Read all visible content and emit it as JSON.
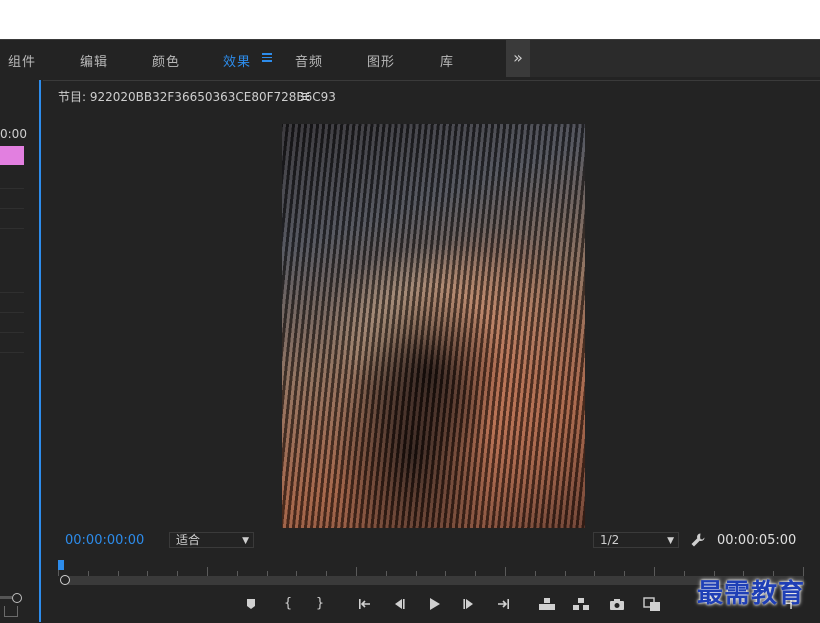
{
  "workspace_tabs": [
    {
      "label": "组件",
      "active": false
    },
    {
      "label": "编辑",
      "active": false
    },
    {
      "label": "颜色",
      "active": false
    },
    {
      "label": "效果",
      "active": true
    },
    {
      "label": "音频",
      "active": false
    },
    {
      "label": "图形",
      "active": false
    },
    {
      "label": "库",
      "active": false
    }
  ],
  "left_panel": {
    "timecode": "0:00"
  },
  "program_monitor": {
    "title": "节目: 922020BB32F36650363CE80F728B6C93",
    "current_time": "00:00:00:00",
    "duration": "00:00:05:00",
    "zoom_select": "适合",
    "resolution_select": "1/2"
  },
  "watermark": "最需教育",
  "colors": {
    "accent": "#2d8ceb",
    "clip": "#e27fe0",
    "background": "#232323"
  },
  "icons": [
    "more-tabs-icon",
    "panel-menu-icon",
    "wrench-icon",
    "marker-icon",
    "mark-in-icon",
    "mark-out-icon",
    "go-to-in-icon",
    "step-back-icon",
    "play-icon",
    "step-forward-icon",
    "go-to-out-icon",
    "lift-icon",
    "extract-icon",
    "camera-icon",
    "compare-icon",
    "add-icon"
  ]
}
